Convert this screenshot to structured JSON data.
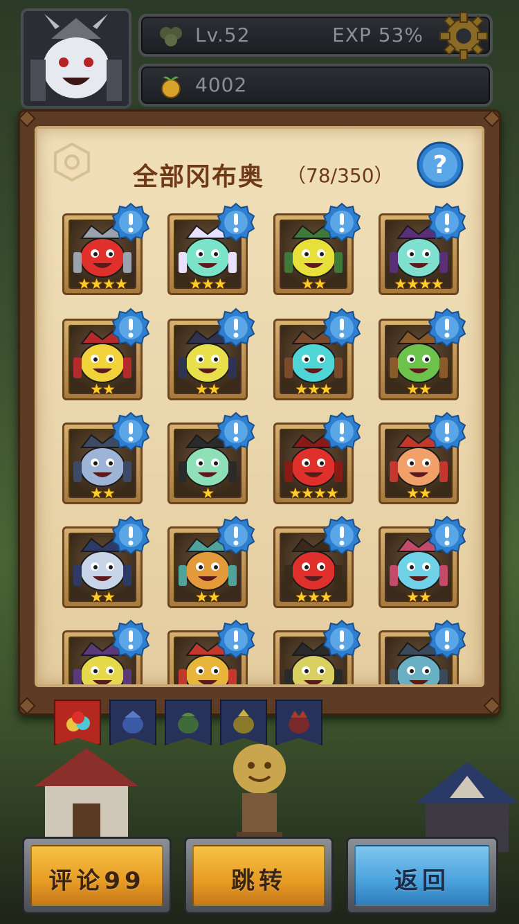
{
  "hud": {
    "level": "Lv.52",
    "exp": "EXP 53%",
    "gold": "4002"
  },
  "panel": {
    "title": "全部冈布奥",
    "count": "（78/350）"
  },
  "cards": [
    {
      "stars": "★★★★",
      "color": "#e0302c",
      "accent": "#9aa3ad"
    },
    {
      "stars": "★★★",
      "color": "#7be3c8",
      "accent": "#e9e0ff"
    },
    {
      "stars": "★★",
      "color": "#e8e03a",
      "accent": "#3f7a3a"
    },
    {
      "stars": "★★★★",
      "color": "#7fe0cf",
      "accent": "#5a2f7a"
    },
    {
      "stars": "★★",
      "color": "#f2d23a",
      "accent": "#b52a2a"
    },
    {
      "stars": "★★",
      "color": "#e7e04a",
      "accent": "#2d3350"
    },
    {
      "stars": "★★★",
      "color": "#4fd5d6",
      "accent": "#7a4a2a"
    },
    {
      "stars": "★★",
      "color": "#6cc24a",
      "accent": "#8a5a2a"
    },
    {
      "stars": "★★",
      "color": "#9db4d6",
      "accent": "#3c4a66"
    },
    {
      "stars": "★",
      "color": "#8fe0b8",
      "accent": "#2a2a2a"
    },
    {
      "stars": "★★★★",
      "color": "#e0302c",
      "accent": "#8a1a16"
    },
    {
      "stars": "★★",
      "color": "#f0a068",
      "accent": "#c2382c"
    },
    {
      "stars": "★★",
      "color": "#c8d4e8",
      "accent": "#2d3a66"
    },
    {
      "stars": "★★",
      "color": "#e39a3a",
      "accent": "#4fa39a"
    },
    {
      "stars": "★★★",
      "color": "#e0302c",
      "accent": "#3a2a1a"
    },
    {
      "stars": "★★",
      "color": "#6fd2e6",
      "accent": "#c44a6a"
    },
    {
      "stars": "",
      "color": "#e5d84a",
      "accent": "#5a3a7a"
    },
    {
      "stars": "",
      "color": "#e8b43a",
      "accent": "#c2382c"
    },
    {
      "stars": "",
      "color": "#d8d060",
      "accent": "#2a2a2a"
    },
    {
      "stars": "",
      "color": "#6ab0c4",
      "accent": "#3a4a5a"
    }
  ],
  "tabs": [
    {
      "name": "all",
      "active": true
    },
    {
      "name": "ice",
      "active": false
    },
    {
      "name": "nature",
      "active": false
    },
    {
      "name": "holy",
      "active": false
    },
    {
      "name": "fire",
      "active": false
    }
  ],
  "buttons": {
    "comment": "评论99",
    "jump": "跳转",
    "back": "返回"
  }
}
